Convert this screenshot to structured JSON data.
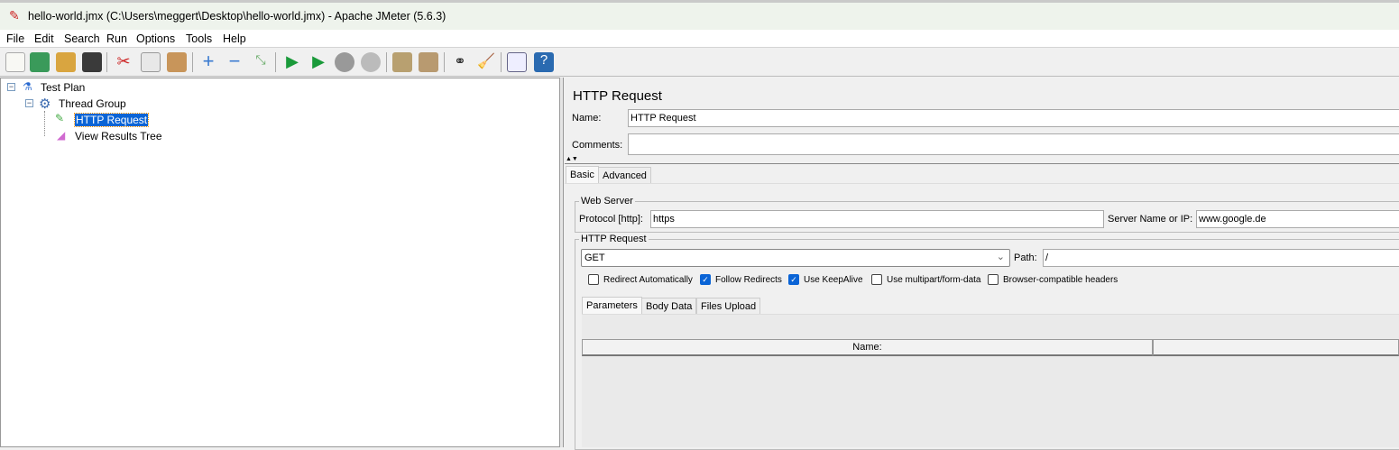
{
  "window": {
    "title": "hello-world.jmx (C:\\Users\\meggert\\Desktop\\hello-world.jmx) - Apache JMeter (5.6.3)"
  },
  "menu": [
    "File",
    "Edit",
    "Search",
    "Run",
    "Options",
    "Tools",
    "Help"
  ],
  "tree": {
    "test_plan": "Test Plan",
    "thread_group": "Thread Group",
    "http_request": "HTTP Request",
    "view_results_tree": "View Results Tree"
  },
  "panel": {
    "title": "HTTP Request",
    "name_label": "Name:",
    "name_value": "HTTP Request",
    "comments_label": "Comments:",
    "comments_value": "",
    "tabs": [
      "Basic",
      "Advanced"
    ],
    "web_server": {
      "legend": "Web Server",
      "protocol_label": "Protocol [http]:",
      "protocol_value": "https",
      "server_label": "Server Name or IP:",
      "server_value": "www.google.de"
    },
    "http_request": {
      "legend": "HTTP Request",
      "method": "GET",
      "path_label": "Path:",
      "path_value": "/"
    },
    "checkboxes": [
      {
        "label": "Redirect Automatically",
        "checked": false
      },
      {
        "label": "Follow Redirects",
        "checked": true
      },
      {
        "label": "Use KeepAlive",
        "checked": true
      },
      {
        "label": "Use multipart/form-data",
        "checked": false
      },
      {
        "label": "Browser-compatible headers",
        "checked": false
      }
    ],
    "sub_tabs": [
      "Parameters",
      "Body Data",
      "Files Upload"
    ],
    "table": {
      "columns": [
        "Name:",
        ""
      ]
    }
  }
}
